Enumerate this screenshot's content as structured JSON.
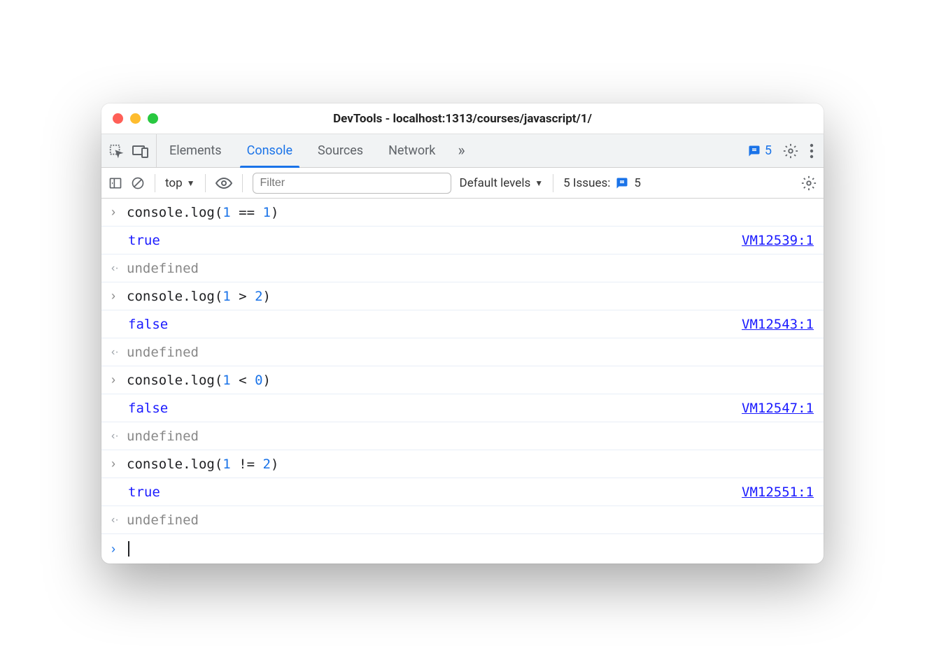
{
  "window": {
    "title": "DevTools - localhost:1313/courses/javascript/1/"
  },
  "tabs": {
    "items": [
      "Elements",
      "Console",
      "Sources",
      "Network"
    ],
    "active": "Console",
    "warning_count": "5"
  },
  "subbar": {
    "context": "top",
    "filter_placeholder": "Filter",
    "levels": "Default levels",
    "issues_label": "5 Issues:",
    "issues_count": "5"
  },
  "console": {
    "entries": [
      {
        "input_prefix": "console.log(",
        "arg1": "1",
        "op": " == ",
        "arg2": "1",
        "input_suffix": ")",
        "result": "true",
        "source": "VM12539:1",
        "return": "undefined"
      },
      {
        "input_prefix": "console.log(",
        "arg1": "1",
        "op": " > ",
        "arg2": "2",
        "input_suffix": ")",
        "result": "false",
        "source": "VM12543:1",
        "return": "undefined"
      },
      {
        "input_prefix": "console.log(",
        "arg1": "1",
        "op": " < ",
        "arg2": "0",
        "input_suffix": ")",
        "result": "false",
        "source": "VM12547:1",
        "return": "undefined"
      },
      {
        "input_prefix": "console.log(",
        "arg1": "1",
        "op": " != ",
        "arg2": "2",
        "input_suffix": ")",
        "result": "true",
        "source": "VM12551:1",
        "return": "undefined"
      }
    ]
  }
}
